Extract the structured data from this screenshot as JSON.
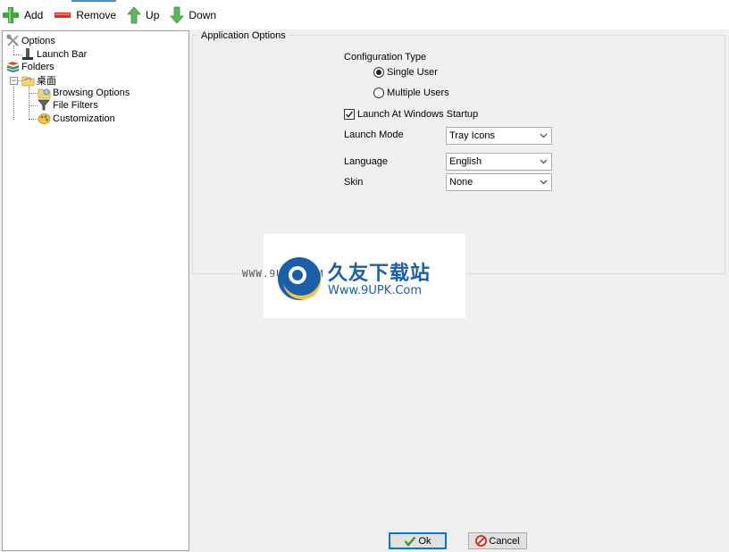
{
  "toolbar": {
    "add_label": "Add",
    "remove_label": "Remove",
    "up_label": "Up",
    "down_label": "Down"
  },
  "tree": {
    "options": "Options",
    "launch_bar": "Launch Bar",
    "folders": "Folders",
    "desktop": "桌面",
    "browsing_options": "Browsing Options",
    "file_filters": "File Filters",
    "customization": "Customization"
  },
  "group": {
    "legend": "Application Options",
    "config_type_label": "Configuration Type",
    "single_user": "Single User",
    "multiple_users": "Multiple Users",
    "selected_config": "Single User",
    "launch_startup": "Launch At Windows Startup",
    "launch_startup_checked": true,
    "launch_mode_label": "Launch Mode",
    "launch_mode_value": "Tray Icons",
    "language_label": "Language",
    "language_value": "English",
    "skin_label": "Skin",
    "skin_value": "None"
  },
  "buttons": {
    "ok_label": "Ok",
    "cancel_label": "Cancel"
  },
  "watermark": {
    "left_text": "WWW.9UPK.COM",
    "cn_text": "久友下载站",
    "url_text": "Www.9UPK.Com"
  },
  "colors": {
    "add_icon": "#3ea83a",
    "remove_icon": "#d9301f",
    "arrow_icon": "#5cb85c",
    "ok_check": "#2e9a2e",
    "cancel_icon": "#d9301f",
    "accent": "#0078d7"
  }
}
